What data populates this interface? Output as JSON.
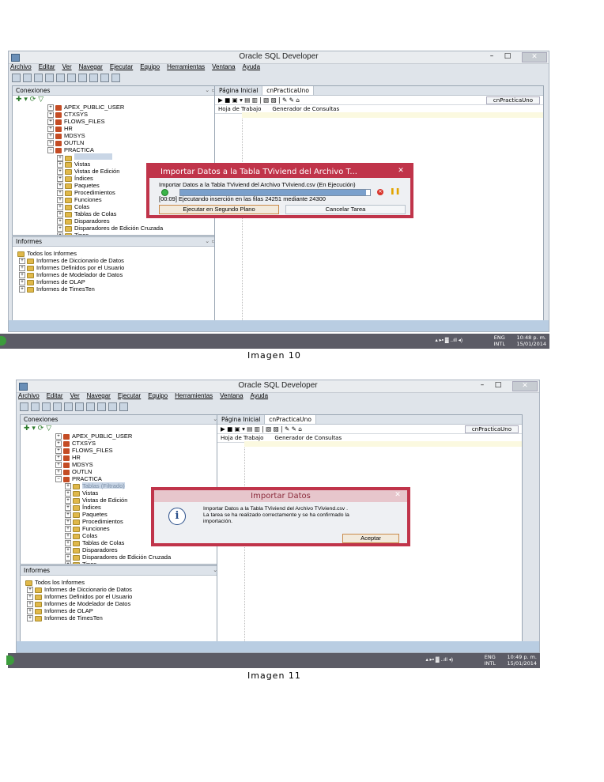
{
  "screenshots": [
    {
      "window_title": "Oracle SQL Developer",
      "menu": [
        "Archivo",
        "Editar",
        "Ver",
        "Navegar",
        "Ejecutar",
        "Equipo",
        "Herramientas",
        "Ventana",
        "Ayuda"
      ],
      "connections_panel_title": "Conexiones",
      "tree": [
        {
          "label": "APEX_PUBLIC_USER",
          "icon": "user-icon",
          "depth": 1
        },
        {
          "label": "CTXSYS",
          "icon": "user-icon",
          "depth": 1
        },
        {
          "label": "FLOWS_FILES",
          "icon": "user-icon",
          "depth": 1
        },
        {
          "label": "HR",
          "icon": "user-icon",
          "depth": 1
        },
        {
          "label": "MDSYS",
          "icon": "user-icon",
          "depth": 1
        },
        {
          "label": "OUTLN",
          "icon": "user-icon",
          "depth": 1
        },
        {
          "label": "PRACTICA",
          "icon": "user-icon",
          "depth": 1
        },
        {
          "label": "",
          "icon": "folder-icon",
          "depth": 2
        },
        {
          "label": "Vistas",
          "icon": "folder-icon",
          "depth": 2
        },
        {
          "label": "Vistas de Edición",
          "icon": "folder-icon",
          "depth": 2
        },
        {
          "label": "Índices",
          "icon": "folder-icon",
          "depth": 2
        },
        {
          "label": "Paquetes",
          "icon": "folder-icon",
          "depth": 2
        },
        {
          "label": "Procedimientos",
          "icon": "folder-icon",
          "depth": 2
        },
        {
          "label": "Funciones",
          "icon": "folder-icon",
          "depth": 2
        },
        {
          "label": "Colas",
          "icon": "folder-icon",
          "depth": 2
        },
        {
          "label": "Tablas de Colas",
          "icon": "folder-icon",
          "depth": 2
        },
        {
          "label": "Disparadores",
          "icon": "folder-icon",
          "depth": 2
        },
        {
          "label": "Disparadores de Edición Cruzada",
          "icon": "folder-icon",
          "depth": 2
        },
        {
          "label": "Tipos",
          "icon": "folder-icon",
          "depth": 2
        }
      ],
      "reports_panel_title": "Informes",
      "reports": [
        {
          "label": "Todos los Informes",
          "depth": 0
        },
        {
          "label": "Informes de Diccionario de Datos",
          "depth": 1
        },
        {
          "label": "Informes Definidos por el Usuario",
          "depth": 1
        },
        {
          "label": "Informes de Modelador de Datos",
          "depth": 1
        },
        {
          "label": "Informes de OLAP",
          "depth": 1
        },
        {
          "label": "Informes de TimesTen",
          "depth": 1
        }
      ],
      "tabs": [
        "Página Inicial",
        "cnPracticaUno"
      ],
      "connection_selector": "cnPracticaUno",
      "subtabs": [
        "Hoja de Trabajo",
        "Generador de Consultas"
      ],
      "dialog": {
        "type": "progress",
        "title": "Importar Datos a la Tabla TViviend del Archivo T...",
        "line1": "Importar Datos a la Tabla TViviend del Archivo TViviend.csv  (En Ejecución)",
        "progress": 0.98,
        "line2": "[00:09] Ejecutando inserción en las filas 24251 mediante 24300",
        "btn_background": "Ejecutar en Segundo Plano",
        "btn_cancel": "Cancelar Tarea"
      },
      "taskbar": {
        "lang1": "ENG",
        "lang2": "INTL",
        "time": "10:48 p. m.",
        "date": "15/01/2014"
      },
      "caption": "Imagen 10"
    },
    {
      "window_title": "Oracle SQL Developer",
      "menu": [
        "Archivo",
        "Editar",
        "Ver",
        "Navegar",
        "Ejecutar",
        "Equipo",
        "Herramientas",
        "Ventana",
        "Ayuda"
      ],
      "connections_panel_title": "Conexiones",
      "tree": [
        {
          "label": "APEX_PUBLIC_USER",
          "icon": "user-icon",
          "depth": 1
        },
        {
          "label": "CTXSYS",
          "icon": "user-icon",
          "depth": 1
        },
        {
          "label": "FLOWS_FILES",
          "icon": "user-icon",
          "depth": 1
        },
        {
          "label": "HR",
          "icon": "user-icon",
          "depth": 1
        },
        {
          "label": "MDSYS",
          "icon": "user-icon",
          "depth": 1
        },
        {
          "label": "OUTLN",
          "icon": "user-icon",
          "depth": 1
        },
        {
          "label": "PRACTICA",
          "icon": "user-icon",
          "depth": 1
        },
        {
          "label": "Tablas (Filtrado)",
          "icon": "folder-icon",
          "depth": 2
        },
        {
          "label": "Vistas",
          "icon": "folder-icon",
          "depth": 2
        },
        {
          "label": "Vistas de Edición",
          "icon": "folder-icon",
          "depth": 2
        },
        {
          "label": "Índices",
          "icon": "folder-icon",
          "depth": 2
        },
        {
          "label": "Paquetes",
          "icon": "folder-icon",
          "depth": 2
        },
        {
          "label": "Procedimientos",
          "icon": "folder-icon",
          "depth": 2
        },
        {
          "label": "Funciones",
          "icon": "folder-icon",
          "depth": 2
        },
        {
          "label": "Colas",
          "icon": "folder-icon",
          "depth": 2
        },
        {
          "label": "Tablas de Colas",
          "icon": "folder-icon",
          "depth": 2
        },
        {
          "label": "Disparadores",
          "icon": "folder-icon",
          "depth": 2
        },
        {
          "label": "Disparadores de Edición Cruzada",
          "icon": "folder-icon",
          "depth": 2
        },
        {
          "label": "Tipos",
          "icon": "folder-icon",
          "depth": 2
        }
      ],
      "reports_panel_title": "Informes",
      "reports": [
        {
          "label": "Todos los Informes",
          "depth": 0
        },
        {
          "label": "Informes de Diccionario de Datos",
          "depth": 1
        },
        {
          "label": "Informes Definidos por el Usuario",
          "depth": 1
        },
        {
          "label": "Informes de Modelador de Datos",
          "depth": 1
        },
        {
          "label": "Informes de OLAP",
          "depth": 1
        },
        {
          "label": "Informes de TimesTen",
          "depth": 1
        }
      ],
      "tabs": [
        "Página Inicial",
        "cnPracticaUno"
      ],
      "connection_selector": "cnPracticaUno",
      "subtabs": [
        "Hoja de Trabajo",
        "Generador de Consultas"
      ],
      "dialog": {
        "type": "info",
        "title": "Importar Datos",
        "line1": "Importar Datos a la Tabla TViviend del Archivo TViviend.csv .",
        "line2": "La tarea se ha realizado correctamente y se ha confirmado la",
        "line3": "importación.",
        "btn_ok": "Aceptar"
      },
      "taskbar": {
        "lang1": "ENG",
        "lang2": "INTL",
        "time": "10:49 p. m.",
        "date": "15/01/2014"
      },
      "caption": "Imagen 11"
    }
  ],
  "colors": {
    "dialog_border": "#c0344a",
    "status_band": "#b9cde2",
    "taskbar": "#5c5c66"
  }
}
